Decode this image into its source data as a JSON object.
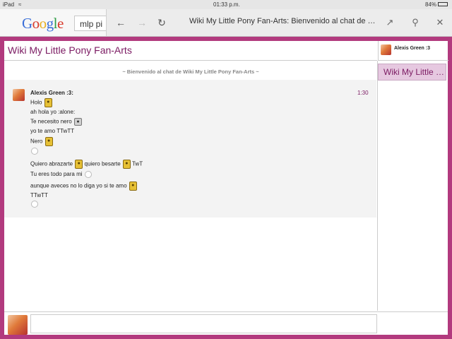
{
  "status_bar": {
    "device": "iPad",
    "time": "01:33 p.m.",
    "battery": "84%"
  },
  "browser": {
    "google_logo": [
      "G",
      "o",
      "o",
      "g",
      "l",
      "e"
    ],
    "search_value": "mlp pi",
    "page_title": "Wiki My Little Pony Fan-Arts: Bienvenido al chat de Wiki..."
  },
  "icons": {
    "back": "back-arrow-icon",
    "forward": "forward-arrow-icon",
    "reload": "reload-icon",
    "share": "share-icon",
    "find": "find-in-page-icon",
    "close": "close-icon"
  },
  "wiki": {
    "title": "Wiki My Little Pony Fan-Arts"
  },
  "user": {
    "name": "Alexis Green :3"
  },
  "room_tab": "Wiki My Little Pony Fan-Arts",
  "welcome": "~ Bienvenido al chat de Wiki My Little Pony Fan-Arts ~",
  "message": {
    "author": "Alexis Green :3:",
    "time": "1:30",
    "lines": {
      "l1": "Holo",
      "l2": "ah hola yo :alone:",
      "l3": "Te necesito nero",
      "l4": "yo te amo TTwTT",
      "l5": "Nero",
      "l7a": "Quiero abrazarte",
      "l7b": "quiero besarte",
      "l7c": "TwT",
      "l8": "Tu eres todo para mi",
      "l9": "aunque aveces no lo diga yo si te amo",
      "l10": "TTwTT"
    }
  },
  "colors": {
    "frame": "#b23a7e",
    "accent": "#7b1a62",
    "tab_bg": "#e6c8e0",
    "message_bg": "#f3f3f3"
  }
}
